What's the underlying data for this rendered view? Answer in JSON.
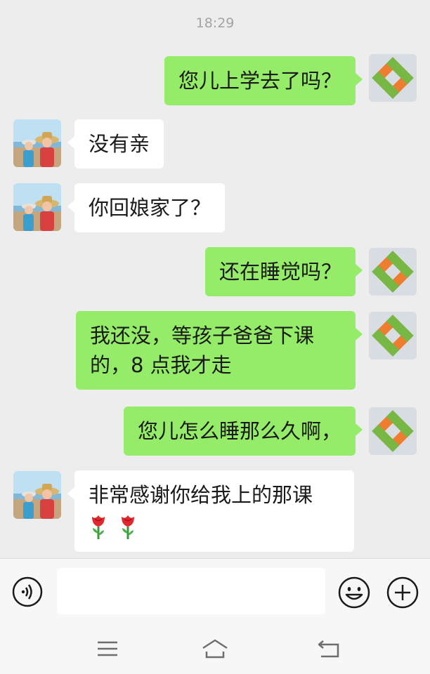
{
  "timestamp": "18:29",
  "messages": [
    {
      "side": "out",
      "text": "您儿上学去了吗？"
    },
    {
      "side": "in",
      "text": "没有亲"
    },
    {
      "side": "in",
      "text": "你回娘家了？"
    },
    {
      "side": "out",
      "text": "还在睡觉吗？"
    },
    {
      "side": "out",
      "text": "我还没，等孩子爸爸下课",
      "text2": "的，8 点我才走"
    },
    {
      "side": "out",
      "text": "您儿怎么睡那么久啊，"
    },
    {
      "side": "in",
      "text": "非常感谢你给我上的那课",
      "emoji": "rose-emoji x2"
    }
  ],
  "input": {
    "placeholder": "",
    "value": ""
  },
  "icons": {
    "voice": "voice-icon",
    "emoji": "emoji-icon",
    "plus": "plus-icon",
    "nav_menu": "menu-icon",
    "nav_home": "home-icon",
    "nav_back": "back-icon"
  },
  "colors": {
    "outgoing_bubble": "#95ec69",
    "incoming_bubble": "#ffffff",
    "background": "#ededed"
  }
}
